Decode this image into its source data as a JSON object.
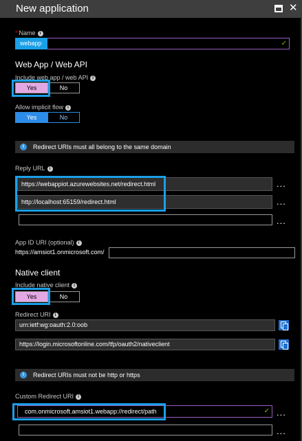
{
  "window": {
    "title": "New application",
    "maximize_icon": "maximize-icon",
    "close_icon": "close-icon"
  },
  "name": {
    "label": "Name",
    "value": "webapp"
  },
  "webapp_section": {
    "heading": "Web App / Web API"
  },
  "include_webapp": {
    "label": "Include web app / web API",
    "yes": "Yes",
    "no": "No",
    "selected": "Yes"
  },
  "implicit_flow": {
    "label": "Allow implicit flow",
    "yes": "Yes",
    "no": "No",
    "selected": "Yes"
  },
  "banner_domain": {
    "text": "Redirect URIs must all belong to the same domain"
  },
  "reply_url": {
    "label": "Reply URL",
    "values": [
      "https://webappiot.azurewebsites.net/redirect.html",
      "http://localhost:65159/redirect.html",
      ""
    ]
  },
  "app_id_uri": {
    "label": "App ID URI (optional)",
    "prefix": "https://amsiot1.onmicrosoft.com/",
    "value": ""
  },
  "native_section": {
    "heading": "Native client"
  },
  "include_native": {
    "label": "Include native client",
    "yes": "Yes",
    "no": "No",
    "selected": "Yes"
  },
  "redirect_uri": {
    "label": "Redirect URI",
    "values": [
      "urn:ietf:wg:oauth:2.0:oob",
      "https://login.microsoftonline.com/tfp/oauth2/nativeclient"
    ]
  },
  "banner_http": {
    "text": "Redirect URIs must not be http or https"
  },
  "custom_redirect": {
    "label": "Custom Redirect URI",
    "values": [
      "com.onmicrosoft.amsiot1.webapp://redirect/path",
      ""
    ]
  },
  "more_label": "...",
  "colors": {
    "highlight": "#1aa0e8",
    "toggle_on": "#e3a8e3",
    "toggle_blue": "#2d8ce8",
    "valid": "#7fba00"
  }
}
